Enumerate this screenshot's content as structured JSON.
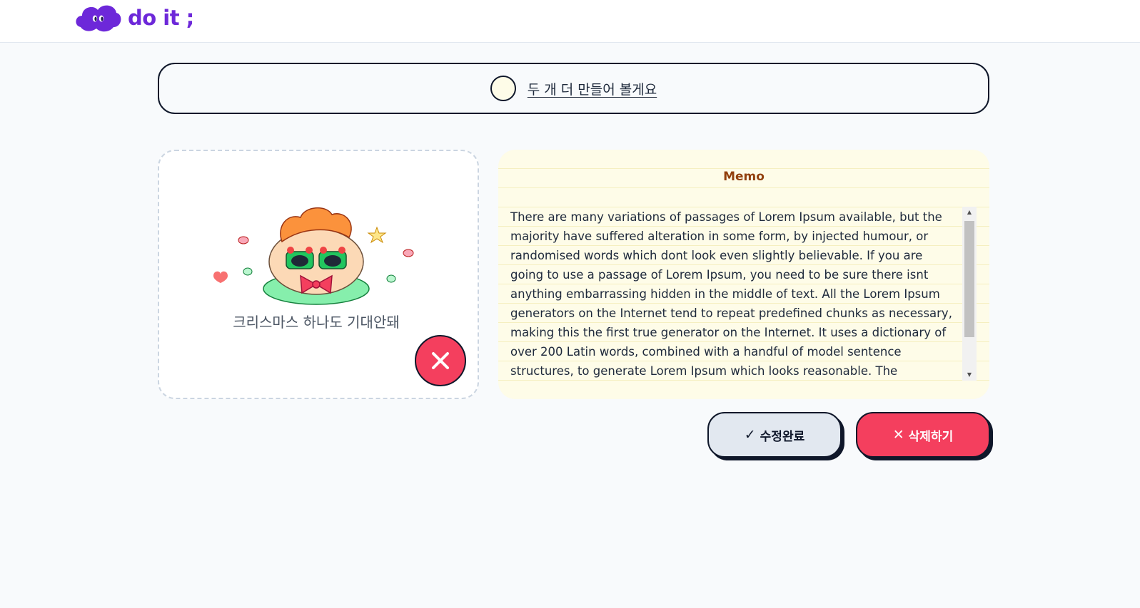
{
  "header": {
    "logo_text": "do it ;",
    "logo_icon": "cloud-eyes-icon",
    "brand_color": "#6d28d9"
  },
  "todo": {
    "title": "두 개 더 만들어 볼게요",
    "completed": false
  },
  "image": {
    "caption": "크리스마스 하나도 기대안돼",
    "delete_icon": "close-icon"
  },
  "memo": {
    "title": "Memo",
    "content": "There are many variations of passages of Lorem Ipsum available, but the majority have suffered alteration in some form, by injected humour, or randomised words which dont look even slightly believable. If you are going to use a passage of Lorem Ipsum, you need to be sure there isnt anything embarrassing hidden in the middle of text. All the Lorem Ipsum generators on the Internet tend to repeat predefined chunks as necessary, making this the first true generator on the Internet. It uses a dictionary of over 200 Latin words, combined with a handful of model sentence structures, to generate Lorem Ipsum which looks reasonable. The generated Lorem Ipsum is"
  },
  "actions": {
    "edit_label": "수정완료",
    "edit_icon": "✓",
    "delete_label": "삭제하기",
    "delete_icon": "✕"
  },
  "colors": {
    "background": "#f8fafc",
    "memo_bg": "#fefce8",
    "memo_title": "#92400e",
    "danger": "#f43f5e",
    "neutral_button": "#e2e8f0"
  }
}
